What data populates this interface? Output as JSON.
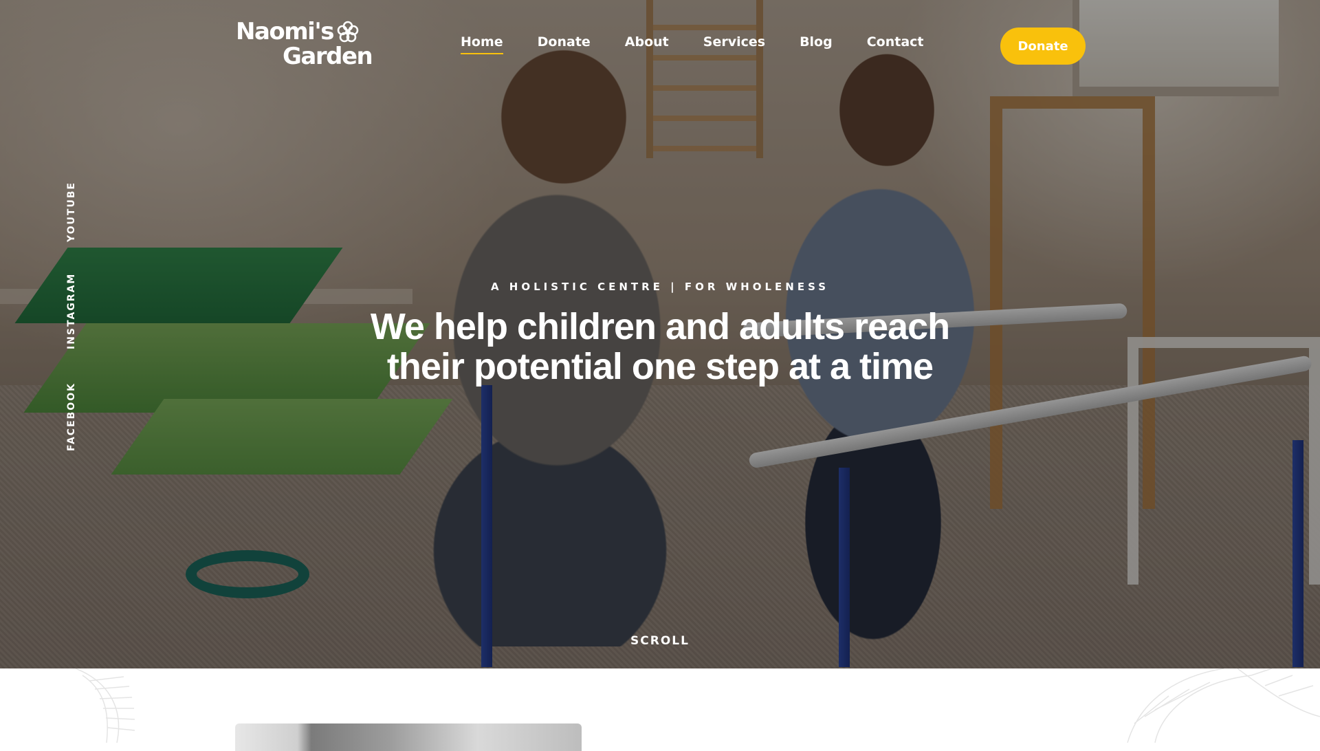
{
  "brand": {
    "logo_line1": "Naomi's",
    "logo_line2": "Garden",
    "logo_icon": "flower-icon"
  },
  "nav": {
    "items": [
      {
        "label": "Home",
        "active": true
      },
      {
        "label": "Donate",
        "active": false
      },
      {
        "label": "About",
        "active": false
      },
      {
        "label": "Services",
        "active": false
      },
      {
        "label": "Blog",
        "active": false
      },
      {
        "label": "Contact",
        "active": false
      }
    ]
  },
  "header": {
    "donate_button": "Donate"
  },
  "social": {
    "youtube": "YOUTUBE",
    "instagram": "INSTAGRAM",
    "facebook": "FACEBOOK"
  },
  "hero": {
    "tagline": "A HOLISTIC CENTRE | FOR WHOLENESS",
    "headline_line1": "We help children and adults reach",
    "headline_line2": "their potential one step at a time",
    "scroll_label": "SCROLL"
  },
  "colors": {
    "accent": "#f9c10c",
    "text_on_hero": "#ffffff",
    "page_background": "#ffffff"
  }
}
